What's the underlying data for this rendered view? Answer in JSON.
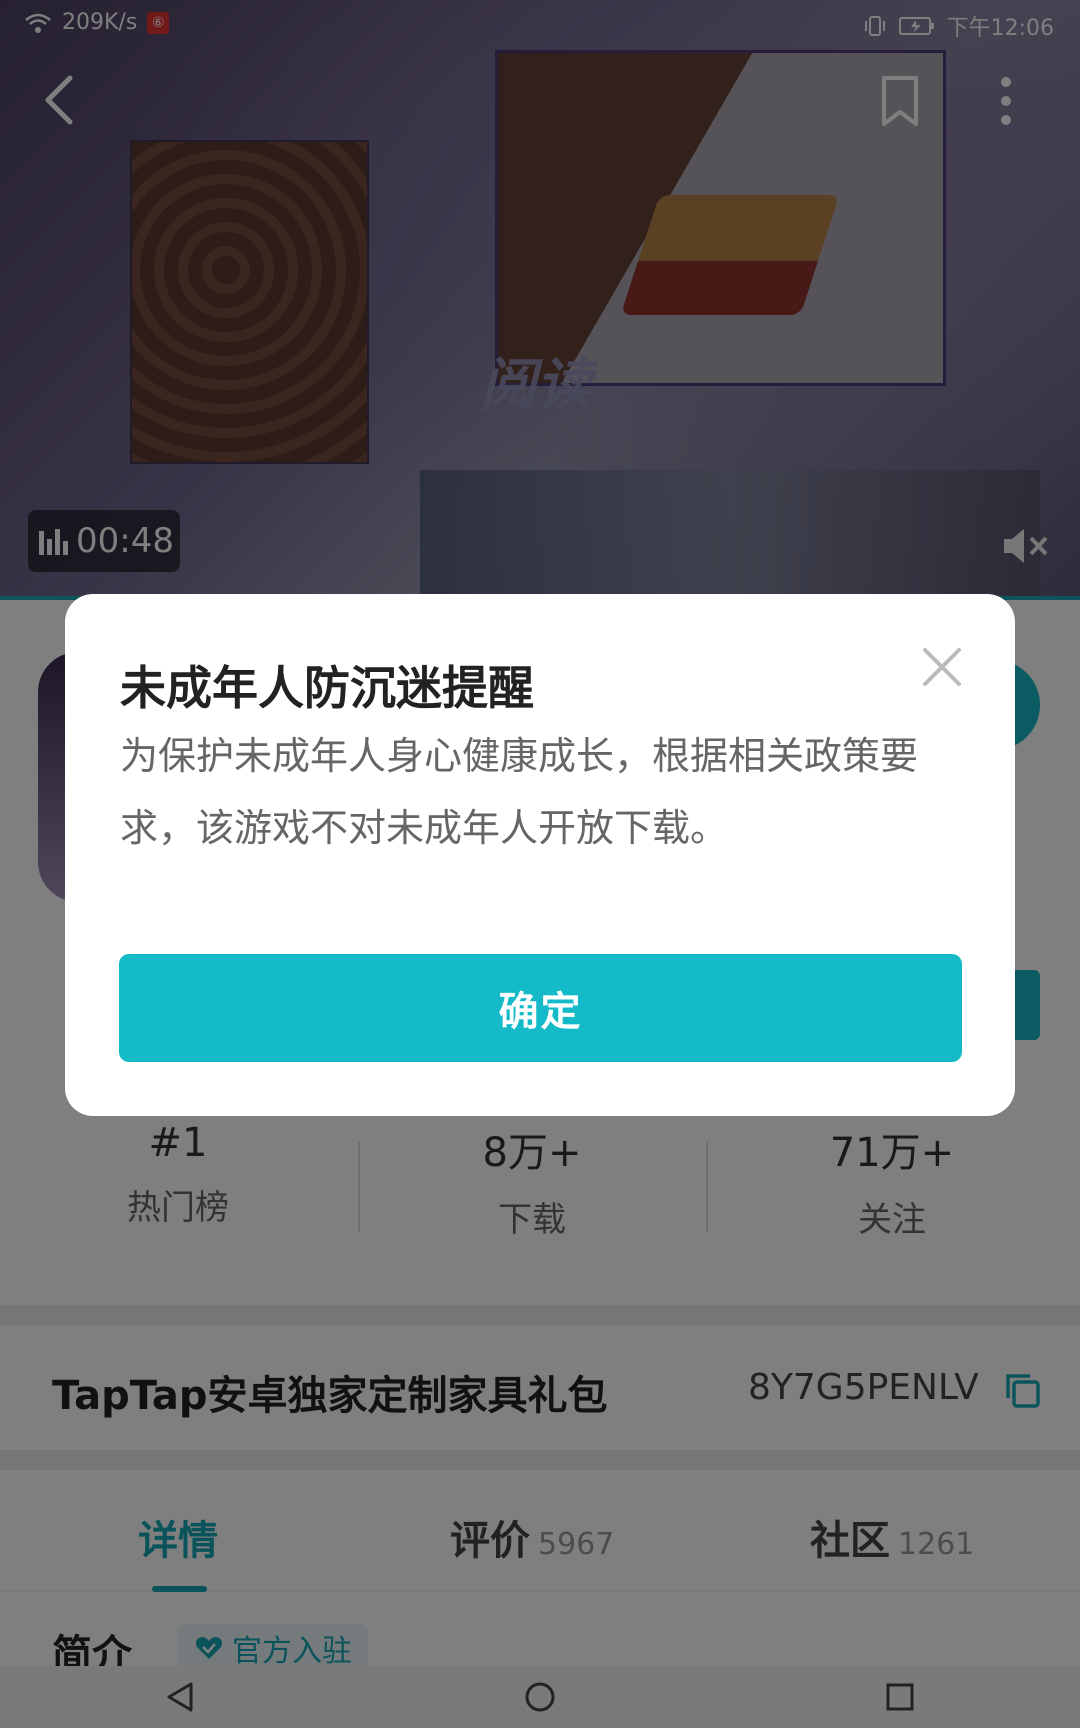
{
  "status_bar": {
    "net_speed": "209K/s",
    "app_badge": "⑥",
    "time": "下午12:06"
  },
  "video": {
    "timer": "00:48",
    "overlay_word": "阅读"
  },
  "stats": [
    {
      "value": "#1",
      "label": "热门榜"
    },
    {
      "value": "8万+",
      "label": "下载"
    },
    {
      "value": "71万+",
      "label": "关注"
    }
  ],
  "gift": {
    "title": "TapTap安卓独家定制家具礼包",
    "code": "8Y7G5PENLV"
  },
  "tabs": [
    {
      "label": "详情",
      "count": ""
    },
    {
      "label": "评价",
      "count": "5967"
    },
    {
      "label": "社区",
      "count": "1261"
    }
  ],
  "intro": {
    "title": "简介",
    "badge": "官方入驻"
  },
  "dialog": {
    "title": "未成年人防沉迷提醒",
    "body": "为保护未成年人身心健康成长，根据相关政策要求，该游戏不对未成年人开放下载。",
    "confirm_label": "确定"
  },
  "colors": {
    "accent": "#15bac8",
    "tab_active": "#16a7b5"
  }
}
